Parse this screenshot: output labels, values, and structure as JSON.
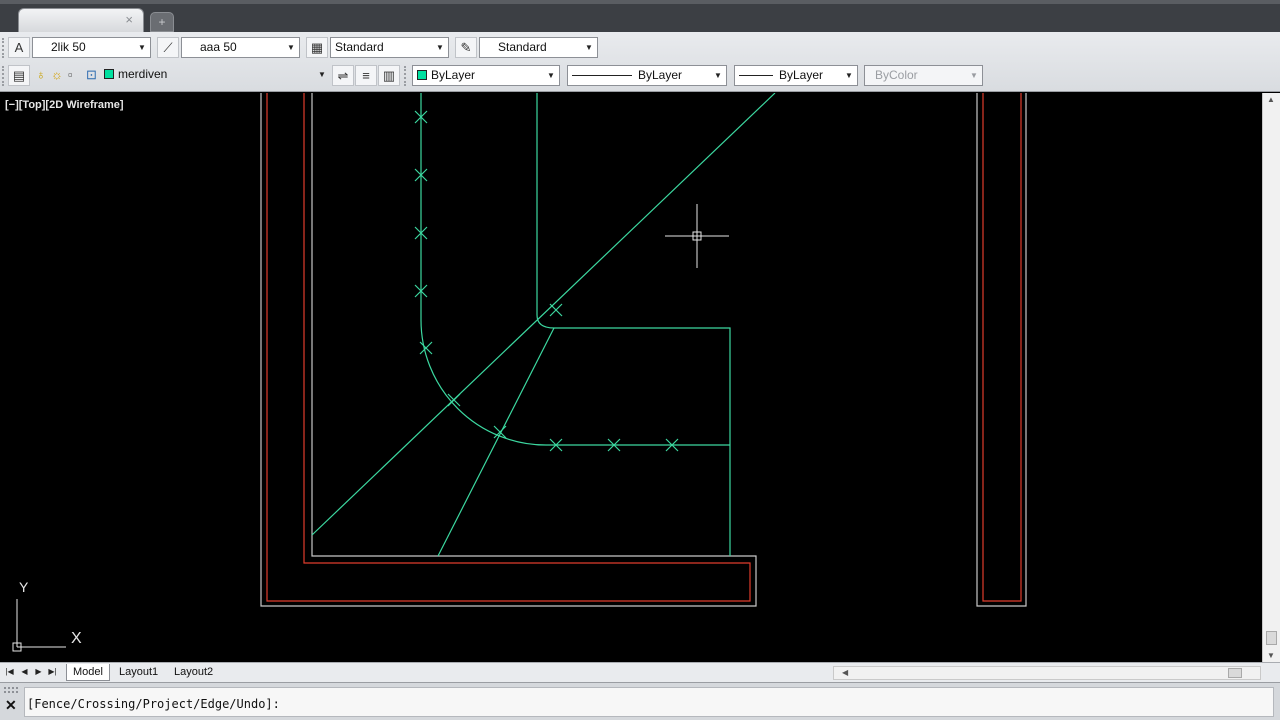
{
  "tabs": {
    "new_tab_label": "+",
    "close_label": "×"
  },
  "toolbar_row1": {
    "text_style_value": "2lik 50",
    "dim_style_value": "aaa 50",
    "table_style_value": "Standard",
    "multileader_style_value": "Standard"
  },
  "toolbar_row2": {
    "layer_value": "merdiven",
    "color_value": "ByLayer",
    "linetype_value": "ByLayer",
    "lineweight_value": "ByLayer",
    "plotstyle_value": "ByColor"
  },
  "viewport": {
    "label": "[−][Top][2D Wireframe]",
    "ucs_y": "Y",
    "ucs_x": "X"
  },
  "layout_tabs": [
    "Model",
    "Layout1",
    "Layout2"
  ],
  "command_line": {
    "prompt": "[Fence/Crossing/Project/Edge/Undo]:"
  },
  "colors": {
    "wall_outline": "#c8c8c8",
    "wall_inner": "#e03c2c",
    "geometry": "#3cd8a0",
    "background": "#000000"
  },
  "icons": [
    "text-style-icon",
    "dim-style-icon",
    "table-style-icon",
    "multileader-style-icon",
    "layer-properties-icon",
    "bulb-icon",
    "sun-icon",
    "freeze-icon",
    "lock-icon",
    "make-current-icon",
    "layer-previous-icon",
    "layer-state-icon",
    "close-icon"
  ]
}
